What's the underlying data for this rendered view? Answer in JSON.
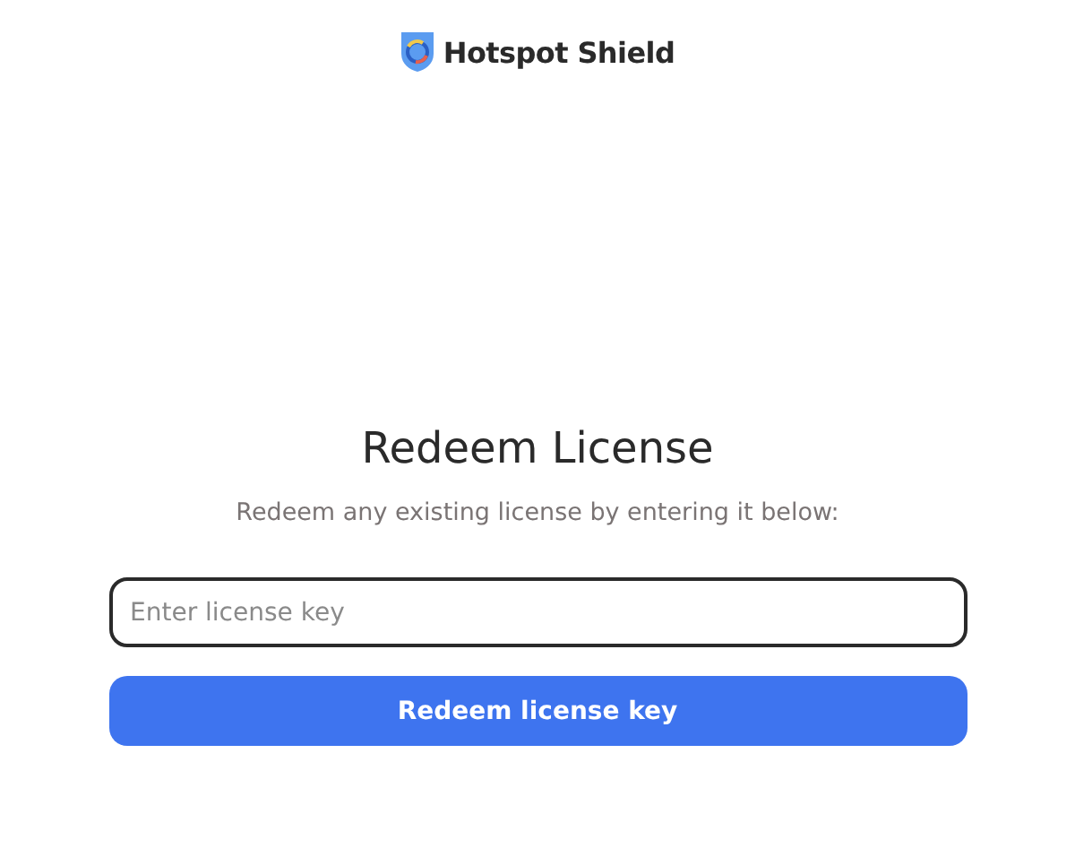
{
  "logo": {
    "text": "Hotspot Shield"
  },
  "title": "Redeem License",
  "subtitle": "Redeem any existing license by entering it below:",
  "license_field": {
    "placeholder": "Enter license key"
  },
  "button": {
    "label": "Redeem license key"
  }
}
